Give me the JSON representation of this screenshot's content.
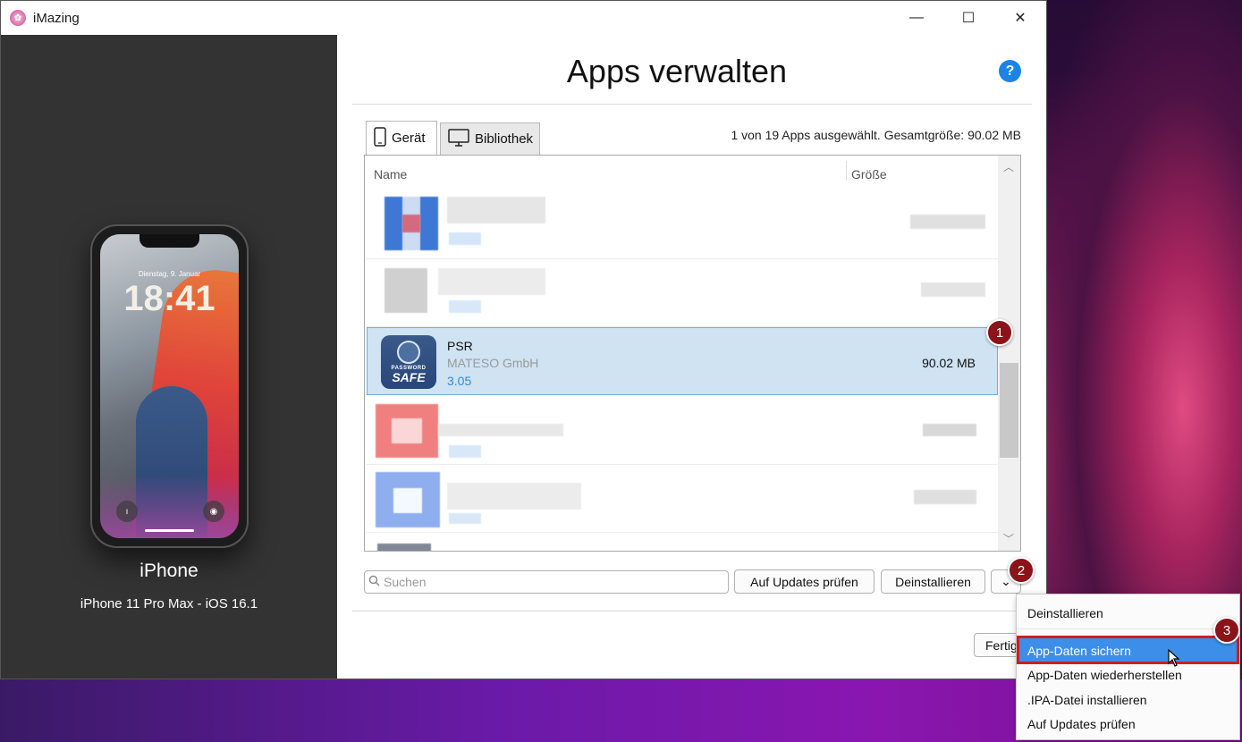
{
  "window": {
    "app_title": "iMazing",
    "minimize_icon": "minimize-icon",
    "maximize_icon": "maximize-icon",
    "close_icon": "close-icon"
  },
  "sidebar": {
    "lock_date": "Dienstag, 9. Januar",
    "lock_time": "18:41",
    "device_name": "iPhone",
    "device_model": "iPhone 11 Pro Max - iOS 16.1"
  },
  "main": {
    "title": "Apps verwalten",
    "help_label": "?",
    "tabs": [
      {
        "label": "Gerät",
        "icon": "phone-icon",
        "active": true
      },
      {
        "label": "Bibliothek",
        "icon": "monitor-icon",
        "active": false
      }
    ],
    "summary": "1 von 19 Apps ausgewählt. Gesamtgröße: 90.02 MB",
    "columns": {
      "name": "Name",
      "size": "Größe"
    },
    "selected_app": {
      "name": "PSR",
      "vendor": "MATESO GmbH",
      "version": "3.05",
      "size": "90.02 MB",
      "icon_text_top": "PASSWORD",
      "icon_text_main": "SAFE"
    },
    "search_placeholder": "Suchen",
    "buttons": {
      "check_updates": "Auf Updates prüfen",
      "uninstall": "Deinstallieren",
      "more": "⌄",
      "done": "Fertig"
    }
  },
  "badges": [
    "1",
    "2",
    "3"
  ],
  "context_menu": {
    "items": [
      "Deinstallieren",
      "App-Daten sichern",
      "App-Daten wiederherstellen",
      ".IPA-Datei installieren",
      "Auf Updates prüfen"
    ],
    "highlighted_index": 1
  },
  "colors": {
    "accent": "#1b84e6",
    "selection": "#cfe3f2",
    "badge": "#8a1418",
    "highlight": "#3d8ee8",
    "annotation_box": "#d01c20",
    "sidebar": "#333333"
  }
}
